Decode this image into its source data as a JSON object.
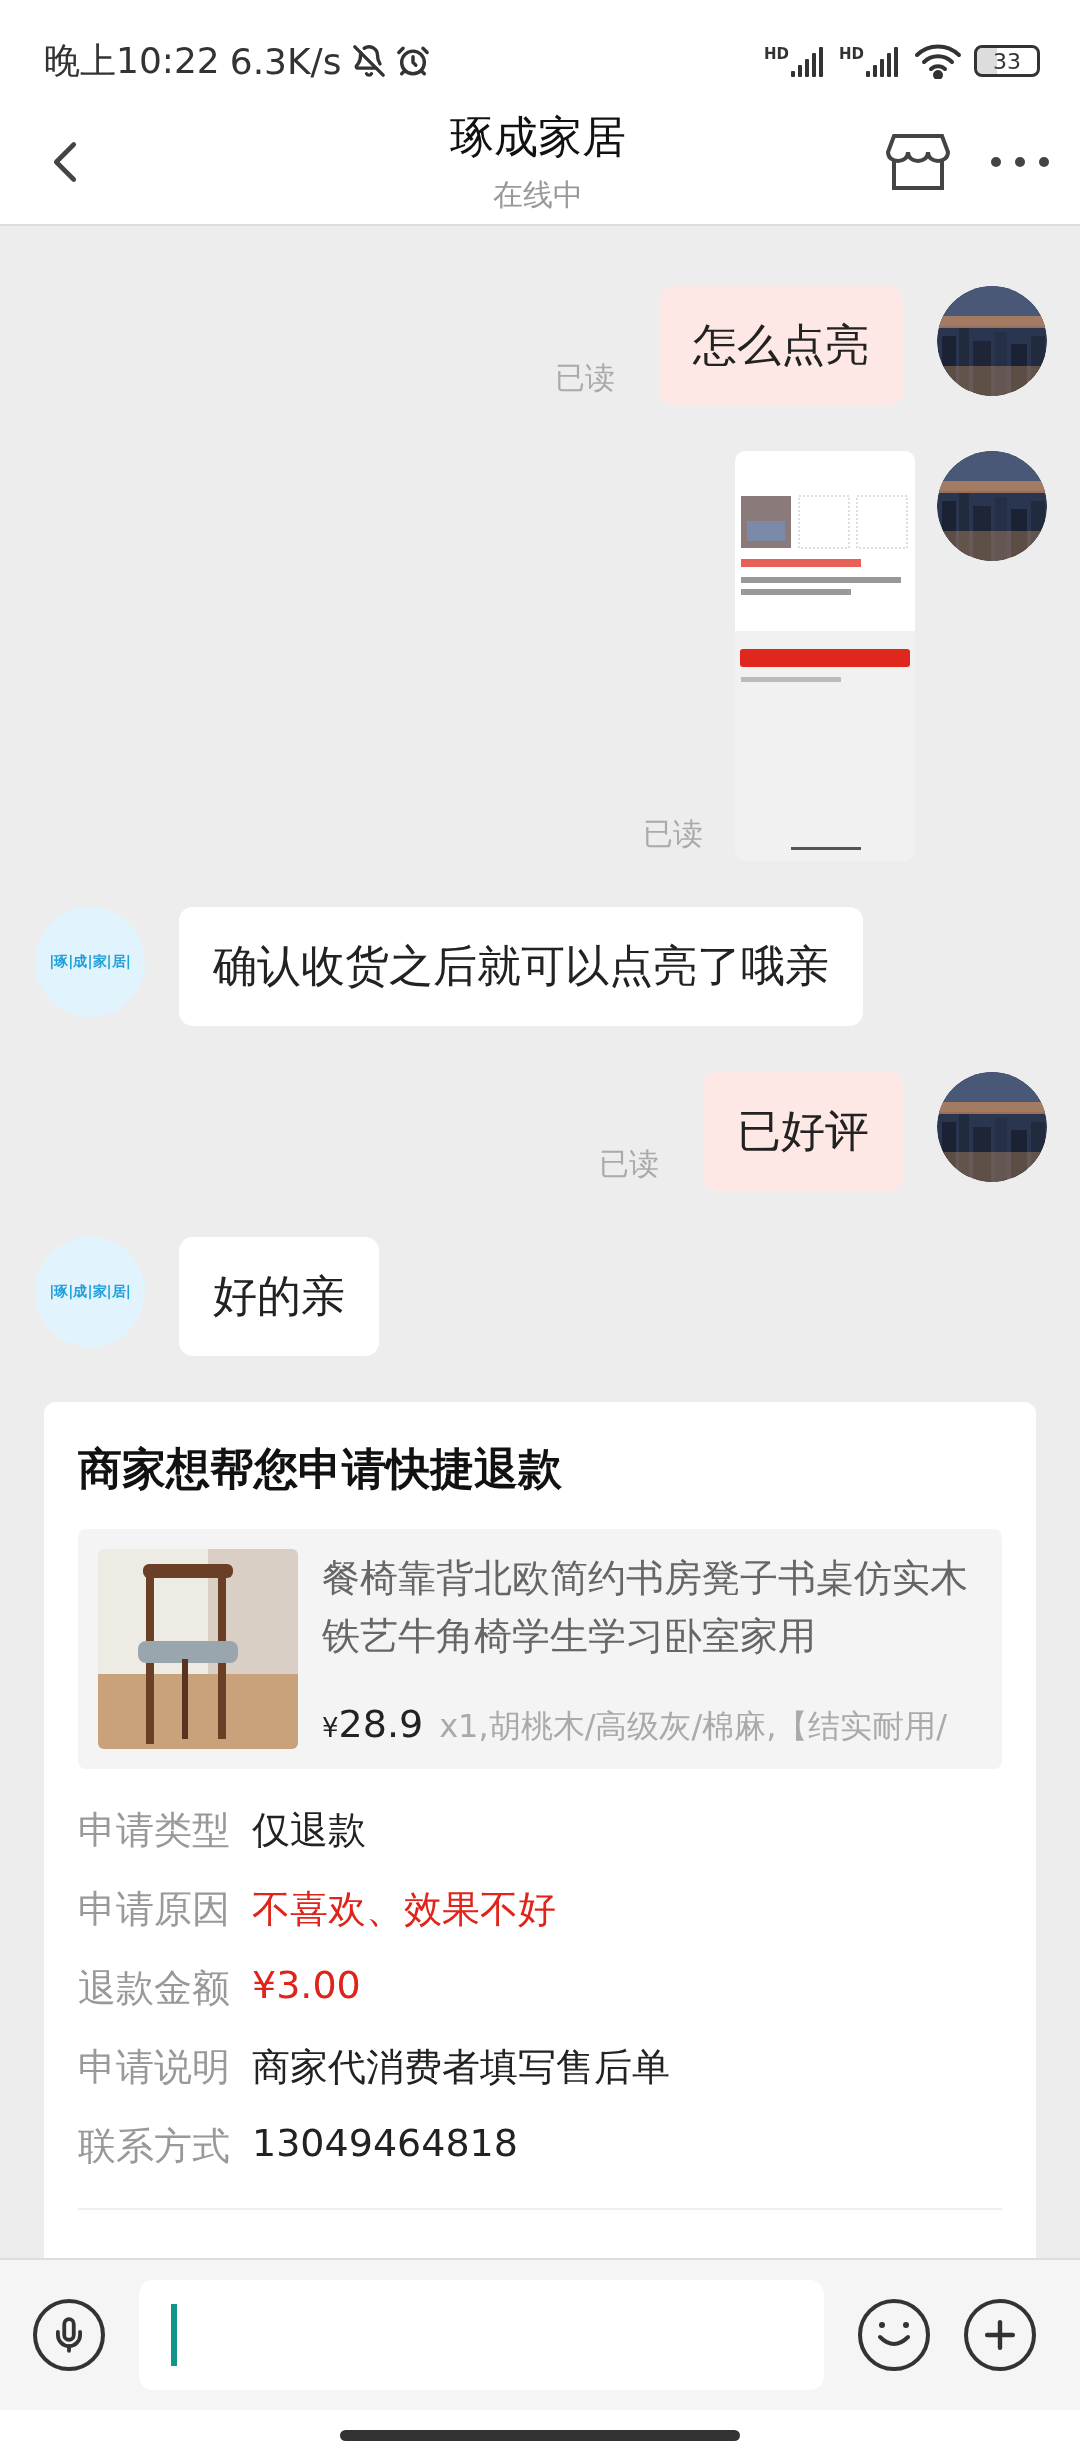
{
  "status_bar": {
    "time": "晚上10:22",
    "speed": "6.3K/s",
    "signals": [
      "HD",
      "HD"
    ],
    "battery": "33"
  },
  "header": {
    "title": "琢成家居",
    "subtitle": "在线中"
  },
  "messages": [
    {
      "kind": "sent-text",
      "text": "怎么点亮",
      "receipt": "已读"
    },
    {
      "kind": "sent-image",
      "receipt": "已读"
    },
    {
      "kind": "received-text",
      "text": "确认收货之后就可以点亮了哦亲",
      "avatar_text": "|琢|成|家|居|"
    },
    {
      "kind": "sent-text",
      "text": "已好评",
      "receipt": "已读"
    },
    {
      "kind": "received-text",
      "text": "好的亲",
      "avatar_text": "|琢|成|家|居|"
    }
  ],
  "refund_card": {
    "title": "商家想帮您申请快捷退款",
    "product": {
      "name": "餐椅靠背北欧简约书房凳子书桌仿实木铁艺牛角椅学生学习卧室家用",
      "currency": "¥",
      "price": "28.9",
      "spec": "x1,胡桃木/高级灰/棉麻,【结实耐用/"
    },
    "details": [
      {
        "label": "申请类型",
        "value": "仅退款",
        "emphasis": false
      },
      {
        "label": "申请原因",
        "value": "不喜欢、效果不好",
        "emphasis": true
      },
      {
        "label": "退款金额",
        "value": "¥3.00",
        "emphasis": true
      },
      {
        "label": "申请说明",
        "value": "商家代消费者填写售后单",
        "emphasis": false
      },
      {
        "label": "联系方式",
        "value": "13049464818",
        "emphasis": false
      }
    ]
  }
}
